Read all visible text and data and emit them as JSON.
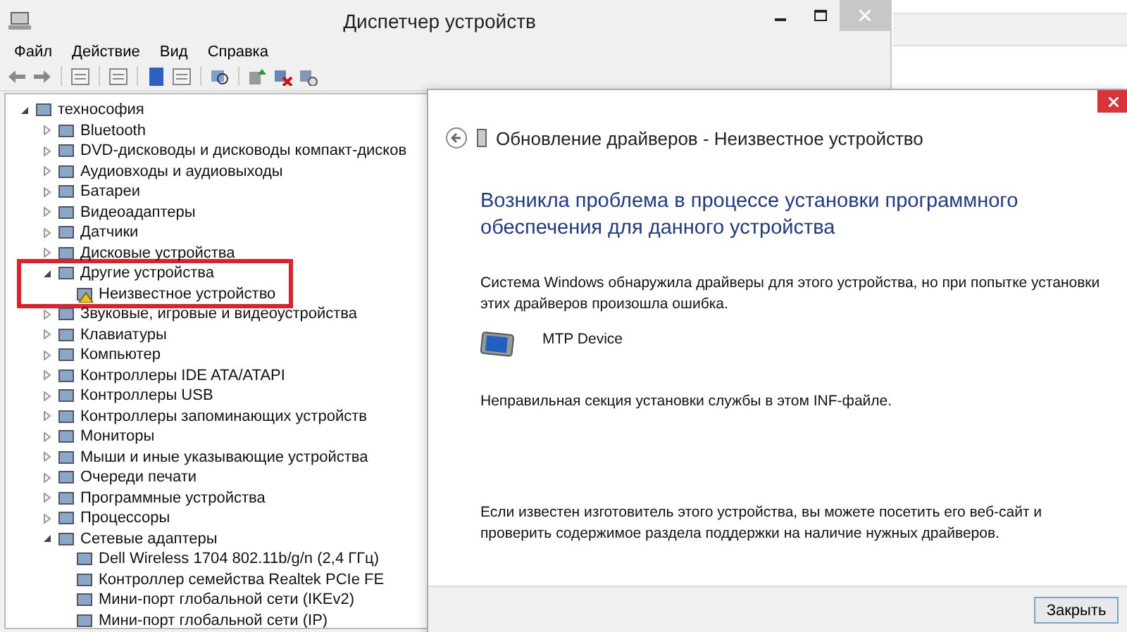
{
  "window": {
    "title": "Диспетчер устройств"
  },
  "menu": [
    "Файл",
    "Действие",
    "Вид",
    "Справка"
  ],
  "tree": {
    "label": "технософия",
    "expanded": true,
    "children": [
      {
        "label": "Bluetooth",
        "expanded": false
      },
      {
        "label": "DVD-дисководы и дисководы компакт-дисков",
        "expanded": false
      },
      {
        "label": "Аудиовходы и аудиовыходы",
        "expanded": false
      },
      {
        "label": "Батареи",
        "expanded": false
      },
      {
        "label": "Видеоадаптеры",
        "expanded": false
      },
      {
        "label": "Датчики",
        "expanded": false
      },
      {
        "label": "Дисковые устройства",
        "expanded": false
      },
      {
        "label": "Другие устройства",
        "expanded": true,
        "highlighted": true,
        "children": [
          {
            "label": "Неизвестное устройство",
            "warning": true
          }
        ]
      },
      {
        "label": "Звуковые, игровые и видеоустройства",
        "expanded": false
      },
      {
        "label": "Клавиатуры",
        "expanded": false
      },
      {
        "label": "Компьютер",
        "expanded": false
      },
      {
        "label": "Контроллеры IDE ATA/ATAPI",
        "expanded": false
      },
      {
        "label": "Контроллеры USB",
        "expanded": false
      },
      {
        "label": "Контроллеры запоминающих устройств",
        "expanded": false
      },
      {
        "label": "Мониторы",
        "expanded": false
      },
      {
        "label": "Мыши и иные указывающие устройства",
        "expanded": false
      },
      {
        "label": "Очереди печати",
        "expanded": false
      },
      {
        "label": "Программные устройства",
        "expanded": false
      },
      {
        "label": "Процессоры",
        "expanded": false
      },
      {
        "label": "Сетевые адаптеры",
        "expanded": true,
        "children": [
          {
            "label": "Dell Wireless 1704 802.11b/g/n (2,4 ГГц)"
          },
          {
            "label": "Контроллер семейства Realtek PCIe FE"
          },
          {
            "label": "Мини-порт глобальной сети (IKEv2)"
          },
          {
            "label": "Мини-порт глобальной сети (IP)"
          }
        ]
      }
    ]
  },
  "dialog": {
    "title": "Обновление драйверов - Неизвестное устройство",
    "heading": "Возникла проблема в процессе установки программного обеспечения для данного устройства",
    "message": "Система Windows обнаружила драйверы для этого устройства, но при попытке установки этих драйверов произошла ошибка.",
    "device": "MTP Device",
    "error": "Неправильная секция установки службы в этом INF-файле.",
    "hint": "Если известен изготовитель этого устройства, вы можете посетить его веб-сайт и проверить содержимое раздела поддержки на наличие нужных драйверов.",
    "buttons": [
      "Закрыть"
    ]
  }
}
